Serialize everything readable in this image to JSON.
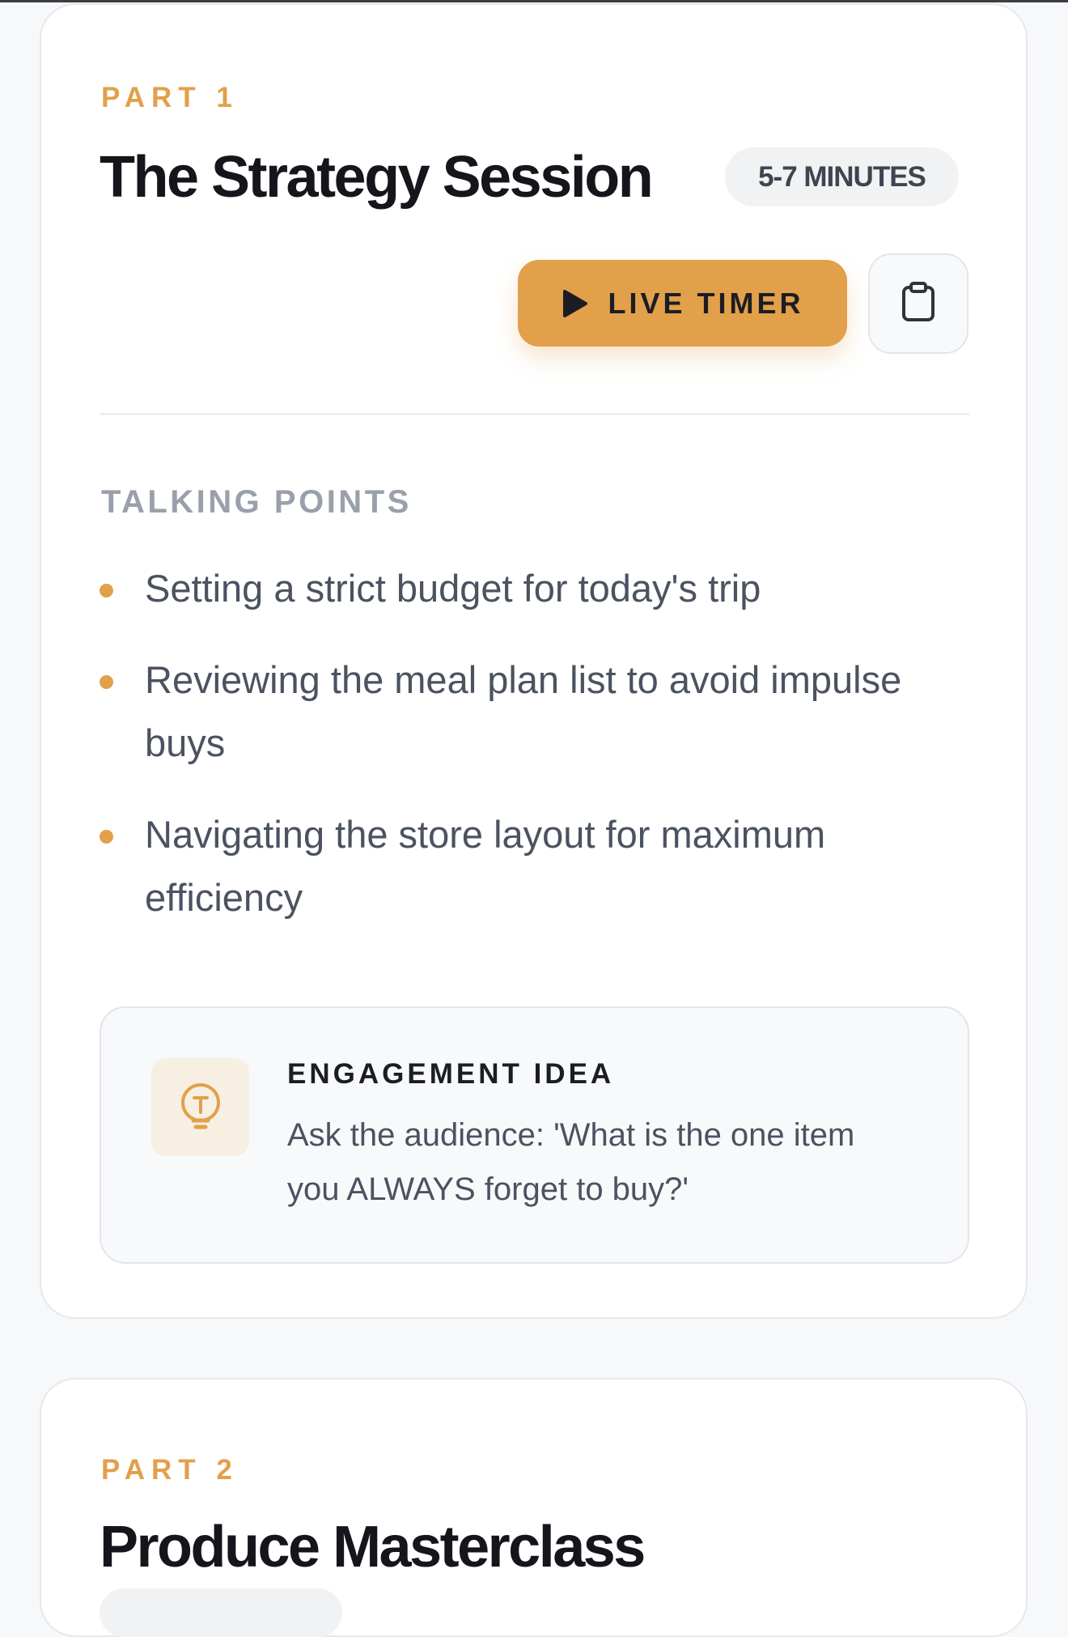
{
  "theme": {
    "accent": "#e2a04a",
    "card_background": "#ffffff",
    "page_background": "#f7f8fa"
  },
  "parts": [
    {
      "label": "PART 1",
      "title": "The Strategy Session",
      "duration": "5-7 MINUTES",
      "timer_label": "LIVE TIMER",
      "copy_icon": "clipboard-icon",
      "section_heading": "TALKING POINTS",
      "talking_points": [
        "Setting a strict budget for today's trip",
        "Reviewing the meal plan list to avoid impulse buys",
        "Navigating the store layout for maximum efficiency"
      ],
      "engagement": {
        "icon": "lightbulb-icon",
        "title": "ENGAGEMENT IDEA",
        "text": "Ask the audience: 'What is the one item you ALWAYS forget to buy?'"
      }
    },
    {
      "label": "PART 2",
      "title": "Produce Masterclass"
    }
  ]
}
